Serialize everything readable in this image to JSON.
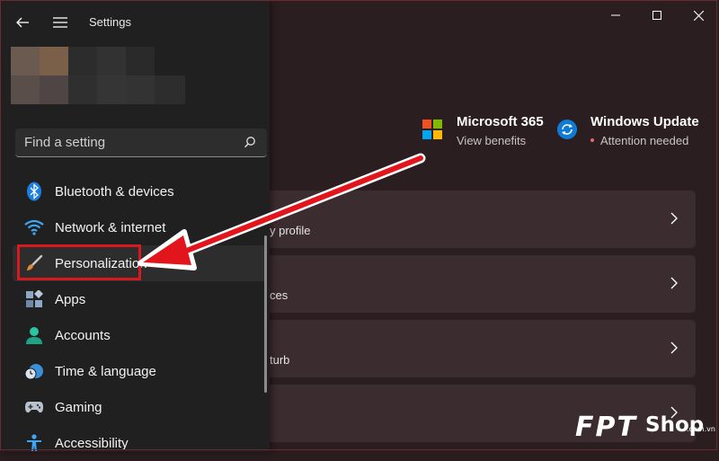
{
  "window": {
    "title": "Settings",
    "controls": [
      "minimize-icon",
      "maximize-icon",
      "close-icon"
    ]
  },
  "search": {
    "placeholder": "Find a setting",
    "value": ""
  },
  "sidebar": {
    "items": [
      {
        "label": "Bluetooth & devices",
        "icon": "bluetooth-icon"
      },
      {
        "label": "Network & internet",
        "icon": "wifi-icon"
      },
      {
        "label": "Personalization",
        "icon": "brush-icon",
        "selected": true
      },
      {
        "label": "Apps",
        "icon": "apps-icon"
      },
      {
        "label": "Accounts",
        "icon": "accounts-icon"
      },
      {
        "label": "Time & language",
        "icon": "clock-globe-icon"
      },
      {
        "label": "Gaming",
        "icon": "gamepad-icon"
      },
      {
        "label": "Accessibility",
        "icon": "accessibility-icon"
      }
    ]
  },
  "header": {
    "microsoft365": {
      "title": "Microsoft 365",
      "subtitle": "View benefits",
      "icon": "microsoft-logo-icon"
    },
    "windows_update": {
      "title": "Windows Update",
      "subtitle": "Attention needed",
      "icon": "update-sync-icon"
    }
  },
  "cards": [
    {
      "text": "y profile"
    },
    {
      "text": "ces"
    },
    {
      "text": "turb"
    },
    {
      "text": ""
    }
  ],
  "annotation": {
    "highlight_color": "#d71920",
    "arrow_color": "#e3151c"
  },
  "watermark": {
    "brand": "FPT",
    "shop": "Shop",
    "domain": ".com.vn"
  },
  "colors": {
    "accent": "#0078d4",
    "sidebar_bg": "#202020",
    "main_bg": "#2b1e21",
    "card_bg": "#3b2c2f"
  }
}
